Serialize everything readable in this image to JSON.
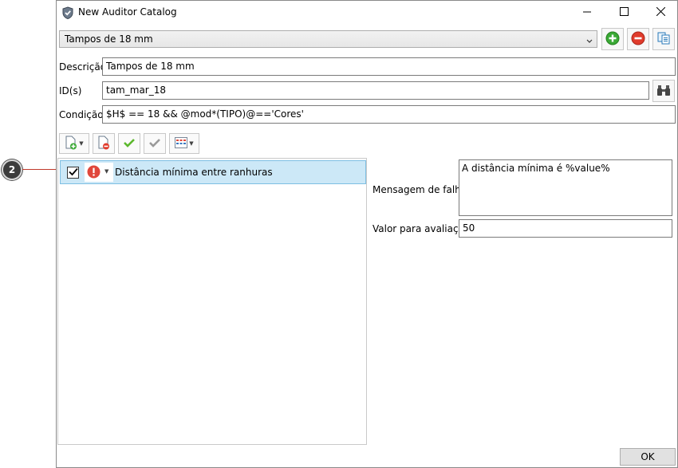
{
  "callout": {
    "number": "2"
  },
  "window": {
    "title": "New Auditor Catalog",
    "controls": {
      "minimize": "minimize-icon",
      "maximize": "maximize-icon",
      "close": "close-icon"
    }
  },
  "catalog": {
    "selected": "Tampos de 18 mm"
  },
  "toolbar_top": {
    "add": "add-icon",
    "remove": "remove-icon",
    "copy": "copy-icon"
  },
  "form": {
    "descricao_label": "Descrição",
    "descricao_value": "Tampos de 18 mm",
    "ids_label": "ID(s)",
    "ids_value": "tam_mar_18",
    "condicao_label": "Condição",
    "condicao_value": "$H$ == 18 && @mod*(TIPO)@=='Cores'"
  },
  "rules_toolbar": {
    "buttons": [
      "add-rule-icon",
      "delete-rule-icon",
      "check-all-icon",
      "uncheck-all-icon",
      "grid-options-icon"
    ]
  },
  "rules": [
    {
      "checked": true,
      "severity": "error",
      "label": "Distância mínima entre ranhuras"
    }
  ],
  "details": {
    "mensagem_label": "Mensagem de falha",
    "mensagem_value": "A distância mínima é %value%",
    "valor_label": "Valor para avaliação",
    "valor_value": "50"
  },
  "footer": {
    "ok_label": "OK"
  },
  "colors": {
    "selection": "#cce8f7",
    "selection_border": "#7dbfe3",
    "add_green": "#3aa935",
    "remove_red": "#e03b2c",
    "error_red": "#e0473b",
    "callout_line": "#c0392b"
  }
}
